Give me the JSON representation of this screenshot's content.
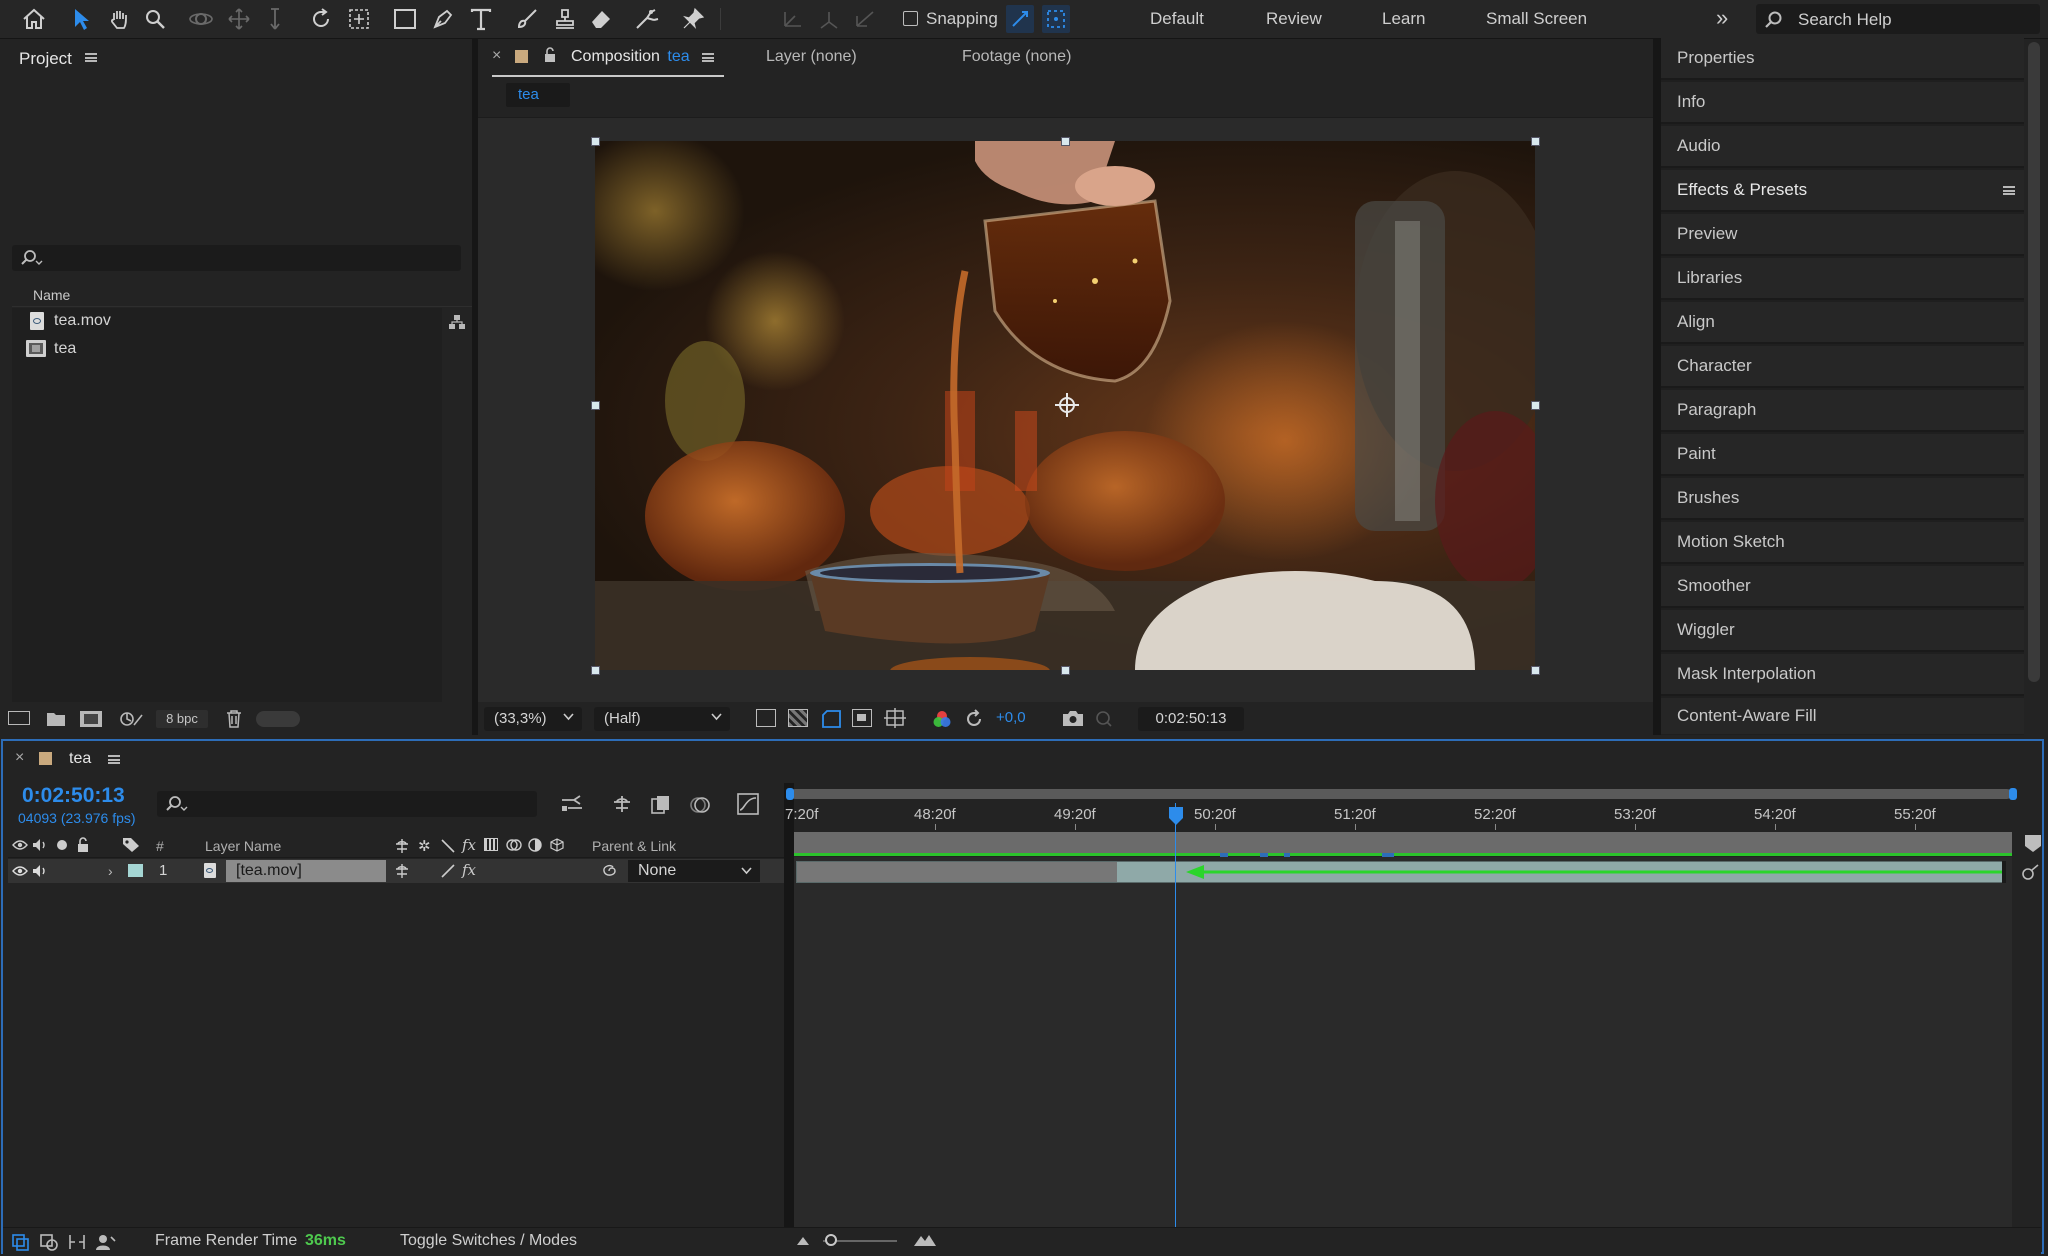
{
  "toolbar": {
    "snapping_label": "Snapping",
    "workspaces": [
      "Default",
      "Review",
      "Learn",
      "Small Screen"
    ],
    "overflow_icon": "double-chevron-right-icon",
    "search_placeholder": "Search Help",
    "accent": "#2d8ceb"
  },
  "project_panel": {
    "title": "Project",
    "column_name": "Name",
    "items": [
      {
        "name": "tea.mov",
        "icon": "footage-file-icon"
      },
      {
        "name": "tea",
        "icon": "composition-icon"
      }
    ],
    "bit_depth": "8 bpc"
  },
  "composition_panel": {
    "tab_prefix": "Composition",
    "tab_comp_name": "tea",
    "layer_tab": "Layer (none)",
    "footage_tab": "Footage (none)",
    "breadcrumb": "tea",
    "zoom": "(33,3%)",
    "resolution": "(Half)",
    "exposure": "+0,0",
    "timecode": "0:02:50:13"
  },
  "right_panels": [
    "Properties",
    "Info",
    "Audio",
    "Effects & Presets",
    "Preview",
    "Libraries",
    "Align",
    "Character",
    "Paragraph",
    "Paint",
    "Brushes",
    "Motion Sketch",
    "Smoother",
    "Wiggler",
    "Mask Interpolation",
    "Content-Aware Fill"
  ],
  "timeline": {
    "comp_name": "tea",
    "current_time": "0:02:50:13",
    "frame_info": "04093 (23.976 fps)",
    "col_number": "#",
    "col_layer_name": "Layer Name",
    "col_parent": "Parent & Link",
    "layer": {
      "index": "1",
      "name": "[tea.mov]",
      "parent": "None"
    },
    "ruler_ticks": [
      "7:20f",
      "48:20f",
      "49:20f",
      "50:20f",
      "51:20f",
      "52:20f",
      "53:20f",
      "54:20f",
      "55:20f"
    ],
    "footer_render_label": "Frame Render Time",
    "footer_render_value": "36ms",
    "footer_toggle": "Toggle Switches / Modes",
    "render_value_color": "#4ec94e"
  }
}
